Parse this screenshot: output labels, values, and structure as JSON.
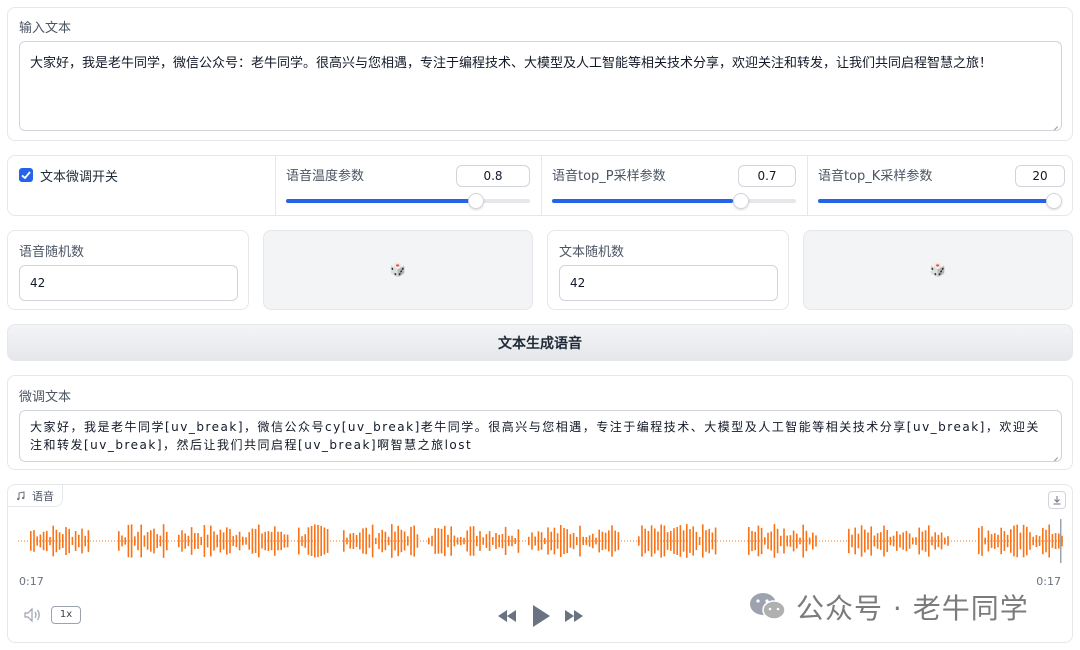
{
  "input_text": {
    "label": "输入文本",
    "value": "大家好，我是老牛同学，微信公众号：老牛同学。很高兴与您相遇，专注于编程技术、大模型及人工智能等相关技术分享，欢迎关注和转发，让我们共同启程智慧之旅！"
  },
  "params": {
    "refine_toggle": {
      "label": "文本微调开关",
      "checked": true
    },
    "temperature": {
      "label": "语音温度参数",
      "value": "0.8",
      "fraction": 0.76
    },
    "top_p": {
      "label": "语音top_P采样参数",
      "value": "0.7",
      "fraction": 0.7
    },
    "top_k": {
      "label": "语音top_K采样参数",
      "value": "20",
      "fraction": 1.0
    }
  },
  "seeds": {
    "audio_seed": {
      "label": "语音随机数",
      "value": "42"
    },
    "text_seed": {
      "label": "文本随机数",
      "value": "42"
    },
    "dice_icon": "🎲"
  },
  "generate_button": {
    "label": "文本生成语音"
  },
  "refined_text": {
    "label": "微调文本",
    "value": "大家好，我是老牛同学[uv_break]，微信公众号cy[uv_break]老牛同学。很高兴与您相遇，专注于编程技术、大模型及人工智能等相关技术分享[uv_break]，欢迎关注和转发[uv_break]，然后让我们共同启程[uv_break]啊智慧之旅lost"
  },
  "audio": {
    "label": "语音",
    "time_current": "0:17",
    "time_total": "0:17",
    "speed": "1x",
    "wave_color": "#f97316"
  },
  "watermark": {
    "text": "公众号 · 老牛同学"
  }
}
